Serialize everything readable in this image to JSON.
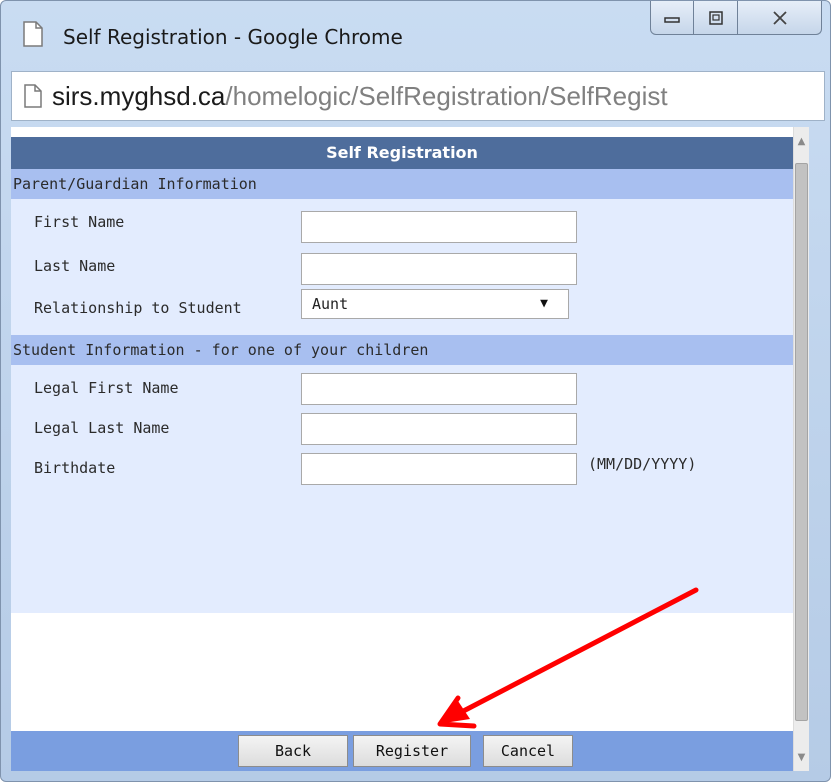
{
  "window": {
    "title": "Self Registration - Google Chrome",
    "url_host": "sirs.myghsd.ca",
    "url_path": "/homelogic/SelfRegistration/SelfRegist"
  },
  "form": {
    "header": "Self Registration",
    "parent_section": "Parent/Guardian Information",
    "first_name_label": "First Name",
    "first_name_value": "",
    "last_name_label": "Last Name",
    "last_name_value": "",
    "relationship_label": "Relationship to Student",
    "relationship_selected": "Aunt",
    "student_section": "Student Information - for one of your children",
    "legal_first_label": "Legal First Name",
    "legal_first_value": "",
    "legal_last_label": "Legal Last Name",
    "legal_last_value": "",
    "birthdate_label": "Birthdate",
    "birthdate_value": "",
    "birthdate_hint": "(MM/DD/YYYY)"
  },
  "buttons": {
    "back": "Back",
    "register": "Register",
    "cancel": "Cancel"
  },
  "icons": {
    "page": "page-icon",
    "minimize": "minimize-icon",
    "restore": "restore-icon",
    "close": "close-icon",
    "select_arrow": "dropdown-arrow-icon",
    "scroll_up": "scroll-up-icon",
    "scroll_down": "scroll-down-icon"
  },
  "colors": {
    "header_bg": "#4e6d9c",
    "section_bg": "#a8bff0",
    "form_bg": "#e3ecfe",
    "footer_bg": "#7a9ee0",
    "annotation_arrow": "#ff0000"
  }
}
